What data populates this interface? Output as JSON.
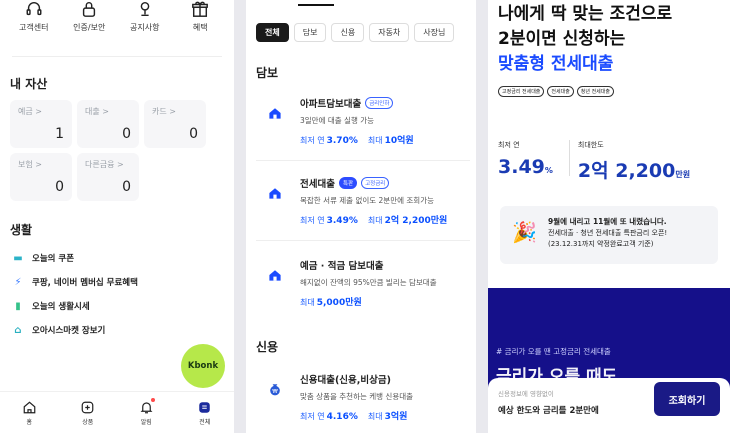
{
  "colors": {
    "accent_blue": "#1a4bff",
    "navy": "#15108a",
    "kbonk_green": "#b6e84a",
    "muted": "#9aa0a8"
  },
  "home": {
    "quick_menu": [
      {
        "icon": "headset-icon",
        "label": "고객센터"
      },
      {
        "icon": "lock-icon",
        "label": "인증/보안"
      },
      {
        "icon": "megaphone-icon",
        "label": "공지사항"
      },
      {
        "icon": "gift-icon",
        "label": "혜택"
      }
    ],
    "assets_title": "내 자산",
    "asset_cards": [
      {
        "label": "예금 >",
        "value": "1"
      },
      {
        "label": "대출 >",
        "value": "0"
      },
      {
        "label": "카드 >",
        "value": "0"
      },
      {
        "label": "보험 >",
        "value": "0"
      },
      {
        "label": "다른금융 >",
        "value": "0"
      }
    ],
    "life_title": "생활",
    "life_items": [
      {
        "icon": "coupon-icon",
        "label": "오늘의 쿠폰"
      },
      {
        "icon": "lightning-icon",
        "label": "쿠팡, 네이버 멤버십 무료혜택"
      },
      {
        "icon": "bar-chart-icon",
        "label": "오늘의 생활시세"
      },
      {
        "icon": "shop-icon",
        "label": "오아시스마켓 장보기"
      }
    ],
    "kbonk_label": "Kbonk",
    "bottom_nav": [
      {
        "icon": "home-icon",
        "label": "홈"
      },
      {
        "icon": "plus-box-icon",
        "label": "상품"
      },
      {
        "icon": "bell-icon",
        "label": "알림"
      },
      {
        "icon": "menu-icon",
        "label": "전체"
      }
    ]
  },
  "loans": {
    "chips": [
      "전체",
      "담보",
      "신용",
      "자동차",
      "사장님"
    ],
    "secured_title": "담보",
    "credit_title": "신용",
    "items": [
      {
        "title": "아파트담보대출",
        "tags": [
          {
            "text": "금리인하",
            "filled": false
          }
        ],
        "desc": "3일만에 대출 실행 가능",
        "rate_label": "최저 연",
        "rate": "3.70%",
        "limit_label": "최대",
        "limit": "10억원"
      },
      {
        "title": "전세대출",
        "tags": [
          {
            "text": "특판",
            "filled": true
          },
          {
            "text": "고정금리",
            "filled": false
          }
        ],
        "desc": "복잡한 서류 제출 없이도 2분만에 조회가능",
        "rate_label": "최저 연",
        "rate": "3.49%",
        "limit_label": "최대",
        "limit": "2억 2,200만원"
      },
      {
        "title": "예금 · 적금 담보대출",
        "tags": [],
        "desc": "해지없이 잔액의 95%만큼 빌리는 담보대출",
        "rate_label": "",
        "rate": "",
        "limit_label": "최대",
        "limit": "5,000만원"
      },
      {
        "title": "신용대출(신용,비상금)",
        "tags": [],
        "desc": "맞춤 상품을 추천하는 케뱅 신용대출",
        "rate_label": "최저 연",
        "rate": "4.16%",
        "limit_label": "최대",
        "limit": "3억원"
      }
    ]
  },
  "promo": {
    "headline_line1": "나에게 딱 맞는 조건으로",
    "headline_line2": "2분이면 신청하는",
    "headline_line3": "맞춤형 전세대출",
    "tags": [
      "고정금리 전세대출",
      "전세대출",
      "청년 전세대출"
    ],
    "min_rate_label": "최저 연",
    "min_rate_value": "3.49",
    "min_rate_unit": "%",
    "max_limit_label": "최대한도",
    "max_limit_value": "2억 2,200",
    "max_limit_unit": "만원",
    "notice_line1": "9월에 내리고 11월에 또 내렸습니다.",
    "notice_line2": "전세대출 · 청년 전세대출 특판금리 오픈!",
    "notice_line3": "(23.12.31까지 약정완료고객 기준)",
    "banner_hashtag": "# 금리가 오를 땐 고정금리 전세대출",
    "banner_text": "금리가 오를 때도",
    "sheet_caption": "신용정보에 영향없이",
    "sheet_text": "예상 한도와 금리를 2분만에",
    "cta_label": "조회하기"
  }
}
